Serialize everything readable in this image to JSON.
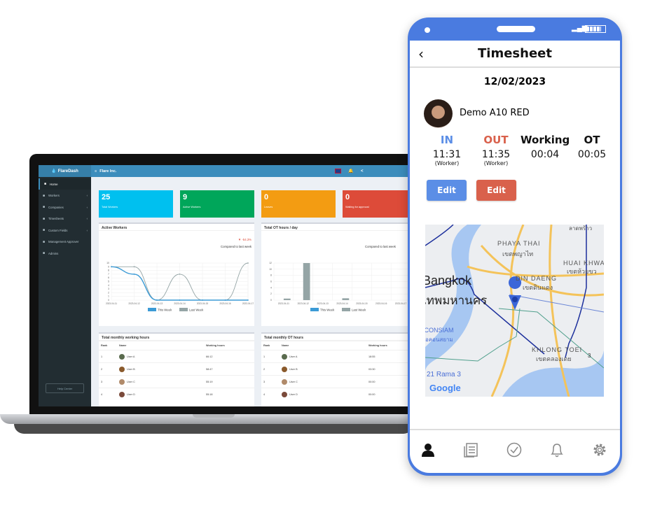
{
  "laptop": {
    "logo": "FlareDash",
    "company": "Flare Inc.",
    "sidebar": [
      {
        "label": "Home",
        "icon": "home-icon"
      },
      {
        "label": "Workers",
        "icon": "users-icon"
      },
      {
        "label": "Companies",
        "icon": "building-icon"
      },
      {
        "label": "Timesheets",
        "icon": "timesheet-icon"
      },
      {
        "label": "Custom Fields",
        "icon": "fields-icon"
      },
      {
        "label": "Management Approver",
        "icon": "user-icon"
      },
      {
        "label": "Admins",
        "icon": "admins-icon"
      }
    ],
    "help": "Help Center",
    "cards": [
      {
        "value": "25",
        "label": "Total Workers",
        "color": "#00c0ef"
      },
      {
        "value": "9",
        "label": "Active Workers",
        "color": "#00a65a"
      },
      {
        "value": "0",
        "label": "Leaves",
        "color": "#f39c12"
      },
      {
        "value": "0",
        "label": "Waiting for approval",
        "color": "#dd4b39"
      }
    ],
    "active_panel": {
      "title": "Active Workers",
      "change": "-54.3%",
      "compare": "Compared to last week"
    },
    "ot_panel": {
      "title": "Total OT hours / day",
      "compare": "Compared to last week"
    },
    "tables": [
      {
        "title": "Total monthly working hours",
        "headers": [
          "Rank",
          "Name",
          "Working hours"
        ],
        "rows": [
          [
            "1",
            "User A",
            "66:12"
          ],
          [
            "2",
            "User B",
            "58:47"
          ],
          [
            "3",
            "User C",
            "55:19"
          ],
          [
            "4",
            "User D",
            "55:18"
          ]
        ]
      },
      {
        "title": "Total monthly OT hours",
        "headers": [
          "Rank",
          "Name",
          "Working hours"
        ],
        "rows": [
          [
            "1",
            "User A",
            "18:55"
          ],
          [
            "2",
            "User B",
            "03:30"
          ],
          [
            "3",
            "User C",
            "00:00"
          ],
          [
            "4",
            "User D",
            "00:00"
          ]
        ]
      }
    ]
  },
  "chart_data": [
    {
      "type": "line",
      "title": "Active Workers",
      "categories": [
        "2023-04-11",
        "2023-04-12",
        "2023-04-13",
        "2023-04-14",
        "2023-04-15",
        "2023-04-16",
        "2023-04-17"
      ],
      "ylim": [
        0,
        10
      ],
      "yticks": [
        0,
        1,
        2,
        3,
        4,
        5,
        6,
        7,
        8,
        9,
        10
      ],
      "grid": true,
      "legend": "bottom",
      "series": [
        {
          "name": "This Week",
          "color": "#3c9bd6",
          "values": [
            9,
            7,
            0,
            0,
            0,
            0,
            0
          ]
        },
        {
          "name": "Last Week",
          "color": "#95a5a6",
          "values": [
            9,
            9,
            0,
            7,
            0,
            0,
            10
          ]
        }
      ]
    },
    {
      "type": "bar",
      "title": "Total OT hours / day",
      "categories": [
        "2023-04-11",
        "2023-04-12",
        "2023-04-13",
        "2023-04-14",
        "2023-04-15",
        "2023-04-16",
        "2023-04-17"
      ],
      "ylim": [
        0,
        12
      ],
      "yticks": [
        0,
        2,
        4,
        6,
        8,
        10,
        12
      ],
      "grid": true,
      "legend": "bottom",
      "series": [
        {
          "name": "This Week",
          "color": "#3c9bd6",
          "values": [
            0,
            0,
            0,
            0,
            0,
            0,
            0
          ]
        },
        {
          "name": "Last Week",
          "color": "#95a5a6",
          "values": [
            0.5,
            12,
            0,
            0.6,
            0,
            0,
            0
          ]
        }
      ]
    }
  ],
  "phone": {
    "title": "Timesheet",
    "date": "12/02/2023",
    "user": "Demo A10 RED",
    "columns": [
      {
        "label": "IN",
        "time": "11:31",
        "by": "(Worker)",
        "color": "#5b8ee6"
      },
      {
        "label": "OUT",
        "time": "11:35",
        "by": "(Worker)",
        "color": "#d9614c"
      },
      {
        "label": "Working",
        "time": "00:04",
        "color": "#111"
      },
      {
        "label": "OT",
        "time": "00:05",
        "color": "#111"
      }
    ],
    "edit_in": "Edit",
    "edit_out": "Edit",
    "map_labels": [
      "PHAYA THAI",
      "เขตพญาไท",
      "HUAI KHWA",
      "เขตห้วยขว",
      "DIN DAENG",
      "เขตดินแดง",
      "Bangkok",
      "เทพมหานคร",
      "ICONSIAM",
      "ไอคอนสยาม",
      "KHLONG TOEI",
      "เขตคลองเตย",
      "21 Rama 3",
      "ลาดพร้าว",
      "3",
      "Google"
    ],
    "nav": [
      "profile-icon",
      "document-icon",
      "check-circle-icon",
      "bell-icon",
      "gear-icon"
    ]
  }
}
